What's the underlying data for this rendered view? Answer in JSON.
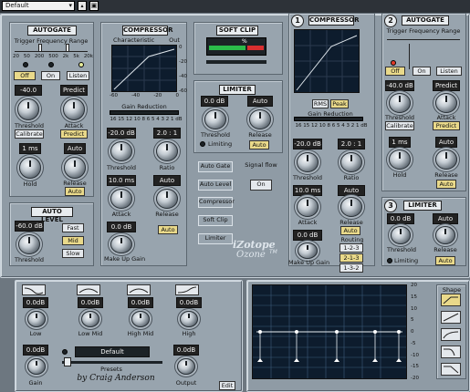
{
  "preset": {
    "name": "Default"
  },
  "autogate": {
    "title": "AUTOGATE",
    "trigger_label": "Trigger Frequency Range",
    "scale": [
      "20",
      "50",
      "200",
      "500",
      "2k",
      "5k",
      "20k"
    ],
    "off": "Off",
    "on": "On",
    "listen": "Listen",
    "threshold": {
      "value": "-40.0 dB",
      "label": "Threshold"
    },
    "calibrate": "Calibrate",
    "attack": {
      "value": "Predict",
      "label": "Attack"
    },
    "predict": "Predict",
    "hold": {
      "value": "1 ms",
      "label": "Hold"
    },
    "release": {
      "value": "Auto",
      "label": "Release"
    },
    "auto": "Auto"
  },
  "autolevel": {
    "title": "AUTO LEVEL",
    "threshold": {
      "value": "-60.0 dB",
      "label": "Threshold"
    },
    "fast": "Fast",
    "mid": "Mid",
    "slow": "Slow"
  },
  "compressor": {
    "title": "COMPRESSOR",
    "characteristic": "Characteristic",
    "out": "Out",
    "xaxis": [
      "-60",
      "-40",
      "-20",
      "0"
    ],
    "yaxis": [
      "0",
      "-20",
      "-40",
      "-60"
    ],
    "gain_reduction": "Gain Reduction",
    "gr_scale": "16 15 12 10 8 6 5 4 3 2 1 dB",
    "threshold": {
      "value": "-20.0 dB",
      "label": "Threshold"
    },
    "ratio": {
      "value": "2.0 : 1",
      "label": "Ratio"
    },
    "attack": {
      "value": "10.0 ms",
      "label": "Attack"
    },
    "release": {
      "value": "Auto",
      "label": "Release"
    },
    "makeup": {
      "value": "0.0 dB",
      "label": "Make Up Gain"
    },
    "auto": "Auto"
  },
  "softclip": {
    "title": "SOFT CLIP",
    "meter_label": "%"
  },
  "limiter": {
    "title": "LIMITER",
    "threshold": {
      "value": "0.0 dB",
      "label": "Threshold"
    },
    "release": {
      "value": "Auto",
      "label": "Release"
    },
    "limiting": "Limiting",
    "auto": "Auto"
  },
  "signalflow": {
    "items": [
      "Auto Gate",
      "Auto Level",
      "Compressor",
      "Soft Clip",
      "Limiter"
    ],
    "title": "Signal flow",
    "on": "On"
  },
  "logo": {
    "brand": "iZotope",
    "product": "Ozone",
    "tm": "TM"
  },
  "comp1": {
    "tab": "1",
    "title": "COMPRESSOR",
    "rms": "RMS",
    "peak": "Peak",
    "gain_reduction": "Gain Reduction",
    "gr_scale": "16 15 12 10 8 6 5 4 3 2 1 dB",
    "threshold": {
      "value": "-20.0 dB",
      "label": "Threshold"
    },
    "ratio": {
      "value": "2.0 : 1",
      "label": "Ratio"
    },
    "attack": {
      "value": "10.0 ms",
      "label": "Attack"
    },
    "release": {
      "value": "Auto",
      "label": "Release"
    },
    "makeup": {
      "value": "0.0 dB",
      "label": "Make Up Gain"
    },
    "auto": "Auto",
    "routing": "Routing",
    "routes": [
      "1-2-3",
      "2-1-3",
      "1-3-2"
    ]
  },
  "gate2": {
    "tab": "2",
    "title": "AUTOGATE",
    "trigger_label": "Trigger Frequency Range",
    "off": "Off",
    "on": "On",
    "listen": "Listen",
    "threshold": {
      "value": "-40.0 dB",
      "label": "Threshold"
    },
    "calibrate": "Calibrate",
    "attack": {
      "value": "Predict",
      "label": "Attack"
    },
    "predict": "Predict",
    "hold": {
      "value": "1 ms",
      "label": "Hold"
    },
    "release": {
      "value": "Auto",
      "label": "Release"
    },
    "auto": "Auto"
  },
  "limiter3": {
    "tab": "3",
    "title": "LIMITER",
    "threshold": {
      "value": "0.0 dB",
      "label": "Threshold"
    },
    "release": {
      "value": "Auto",
      "label": "Release"
    },
    "limiting": "Limiting",
    "auto": "Auto"
  },
  "eq": {
    "bands": [
      {
        "value": "0.0dB",
        "label": "Low"
      },
      {
        "value": "0.0dB",
        "label": "Low Mid"
      },
      {
        "value": "0.0dB",
        "label": "High Mid"
      },
      {
        "value": "0.0dB",
        "label": "High"
      }
    ],
    "gain": {
      "value": "0.0dB",
      "label": "Gain"
    },
    "output": {
      "value": "0.0dB",
      "label": "Output"
    },
    "preset": "Default",
    "presets_label": "Presets",
    "author": "by Craig Anderson",
    "edit": "Edit",
    "db_scale": [
      "20",
      "15",
      "10",
      "5",
      "0",
      "-5",
      "-10",
      "-15",
      "-20"
    ],
    "shape": "Shape"
  }
}
